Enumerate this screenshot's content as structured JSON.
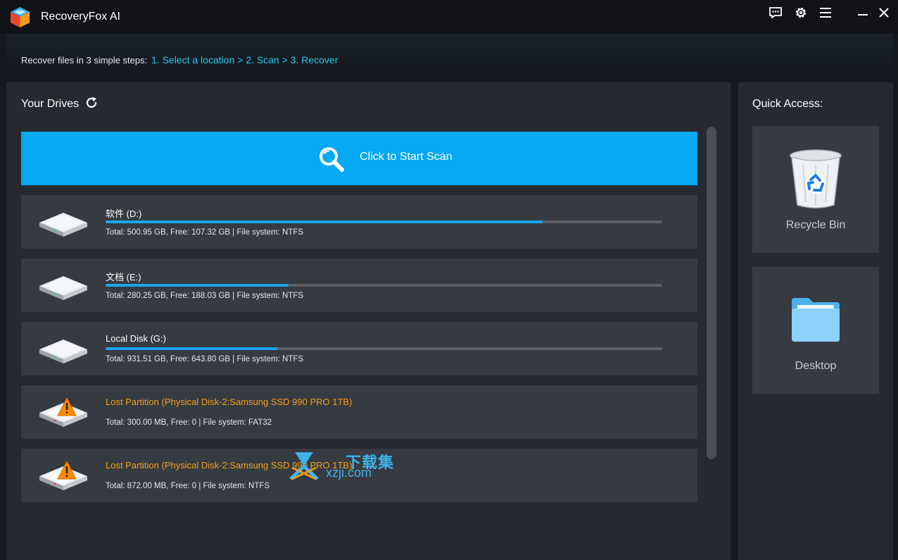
{
  "window": {
    "title": "RecoveryFox AI",
    "accent_color": "#05a9f4",
    "warning_color": "#f0a21d",
    "title_icons": [
      "chat-icon",
      "gear-icon",
      "menu-icon",
      "minimize-icon",
      "close-icon"
    ]
  },
  "steps": {
    "intro": "Recover files in 3 simple steps:",
    "path": "1. Select a location > 2. Scan > 3. Recover"
  },
  "drives": {
    "title": "Your Drives",
    "scan_button": "Click to Start Scan",
    "items": [
      {
        "name": "软件 (D:)",
        "used_fraction": 0.785,
        "info": "Total: 500.95 GB, Free: 107.32 GB | File system: NTFS",
        "lost": false,
        "icon": "hard-drive-icon"
      },
      {
        "name": "文档 (E:)",
        "used_fraction": 0.329,
        "info": "Total: 280.25 GB, Free: 188.03 GB | File system: NTFS",
        "lost": false,
        "icon": "hard-drive-icon"
      },
      {
        "name": "Local Disk (G:)",
        "used_fraction": 0.309,
        "info": "Total: 931.51 GB, Free: 643.80 GB | File system: NTFS",
        "lost": false,
        "icon": "hard-drive-icon"
      },
      {
        "name": "Lost Partition (Physical Disk-2:Samsung SSD 990 PRO 1TB)",
        "info": "Total: 300.00 MB, Free: 0 | File system: FAT32",
        "lost": true,
        "icon": "hard-drive-warning-icon"
      },
      {
        "name": "Lost Partition (Physical Disk-2:Samsung SSD 990 PRO 1TB)",
        "info": "Total: 872.00 MB, Free: 0 | File system: NTFS",
        "lost": true,
        "icon": "hard-drive-warning-icon"
      }
    ]
  },
  "quick_access": {
    "title": "Quick Access:",
    "items": [
      {
        "label": "Recycle Bin",
        "icon": "recycle-bin-icon"
      },
      {
        "label": "Desktop",
        "icon": "folder-icon"
      }
    ]
  },
  "watermark": {
    "line1": "下载集",
    "line2": "xzji.com"
  }
}
